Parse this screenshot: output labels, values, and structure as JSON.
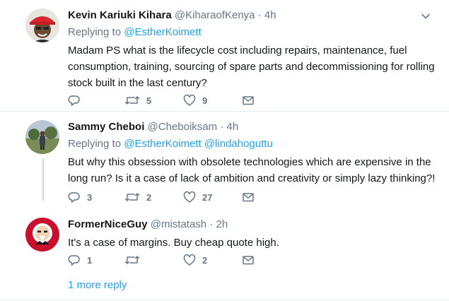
{
  "tweets": [
    {
      "name": "Kevin Kariuki Kihara",
      "handle": "@KiharaofKenya",
      "separator": "·",
      "time": "4h",
      "replying_label": "Replying to",
      "mentions": [
        "@EstherKoimett"
      ],
      "text": "Madam PS what is the lifecycle cost including repairs, maintenance, fuel consumption, training, sourcing of spare parts and decommissioning for rolling stock built in the last century?",
      "reply_count": "",
      "retweet_count": "5",
      "like_count": "9"
    },
    {
      "name": "Sammy Cheboi",
      "handle": "@Cheboiksam",
      "separator": "·",
      "time": "4h",
      "replying_label": "Replying to",
      "mentions": [
        "@EstherKoimett",
        "@lindahoguttu"
      ],
      "text": "But why this obsession with obsolete technologies which are expensive in the long run? Is it a case of lack of ambition and creativity or simply lazy thinking?!",
      "reply_count": "3",
      "retweet_count": "2",
      "like_count": "27"
    },
    {
      "name": "FormerNiceGuy",
      "handle": "@mistatash",
      "separator": "·",
      "time": "2h",
      "text": "It's a case of margins. Buy cheap quote high.",
      "reply_count": "1",
      "retweet_count": "",
      "like_count": "2"
    }
  ],
  "more_reply_label": "1 more reply",
  "colors": {
    "accent": "#1da1f2",
    "muted": "#657786",
    "divider": "#e6ecf0",
    "thread_line": "#ccd6dd"
  }
}
